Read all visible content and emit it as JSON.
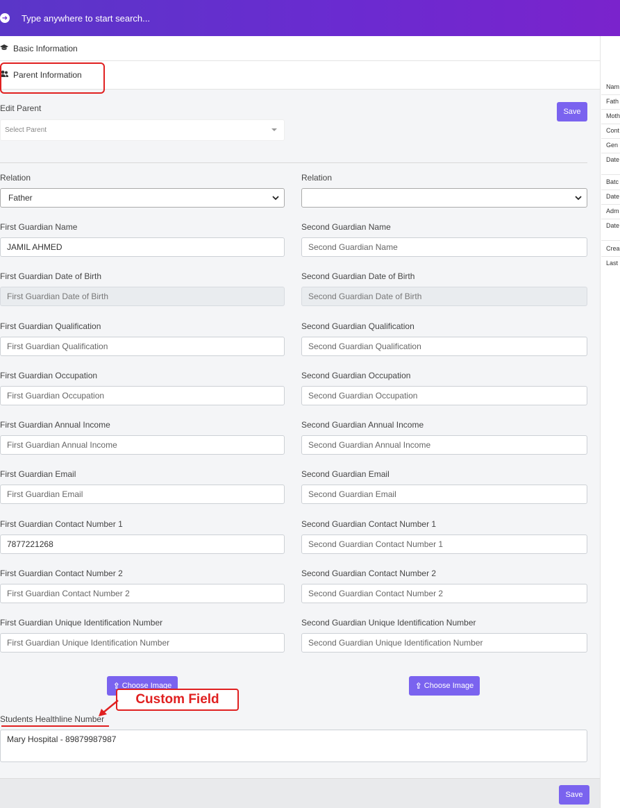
{
  "search": {
    "placeholder": "Type anywhere to start search...",
    "icon": "arrow-circle-right-icon"
  },
  "tabs": [
    {
      "label": "Basic Information",
      "icon": "graduation-cap-icon"
    },
    {
      "label": "Parent Information",
      "icon": "users-icon"
    }
  ],
  "edit_parent": {
    "label": "Edit Parent",
    "placeholder": "Select Parent"
  },
  "save_label": "Save",
  "first": {
    "relation_label": "Relation",
    "relation_value": "Father",
    "name_label": "First Guardian Name",
    "name_value": "JAMIL AHMED",
    "dob_label": "First Guardian Date of Birth",
    "dob_placeholder": "First Guardian Date of Birth",
    "qual_label": "First Guardian Qualification",
    "qual_placeholder": "First Guardian Qualification",
    "occ_label": "First Guardian Occupation",
    "occ_placeholder": "First Guardian Occupation",
    "income_label": "First Guardian Annual Income",
    "income_placeholder": "First Guardian Annual Income",
    "email_label": "First Guardian Email",
    "email_placeholder": "First Guardian Email",
    "contact1_label": "First Guardian Contact Number 1",
    "contact1_value": "7877221268",
    "contact2_label": "First Guardian Contact Number 2",
    "contact2_placeholder": "First Guardian Contact Number 2",
    "uid_label": "First Guardian Unique Identification Number",
    "uid_placeholder": "First Guardian Unique Identification Number"
  },
  "second": {
    "relation_label": "Relation",
    "relation_value": "",
    "name_label": "Second Guardian Name",
    "name_placeholder": "Second Guardian Name",
    "dob_label": "Second Guardian Date of Birth",
    "dob_placeholder": "Second Guardian Date of Birth",
    "qual_label": "Second Guardian Qualification",
    "qual_placeholder": "Second Guardian Qualification",
    "occ_label": "Second Guardian Occupation",
    "occ_placeholder": "Second Guardian Occupation",
    "income_label": "Second Guardian Annual Income",
    "income_placeholder": "Second Guardian Annual Income",
    "email_label": "Second Guardian Email",
    "email_placeholder": "Second Guardian Email",
    "contact1_label": "Second Guardian Contact Number 1",
    "contact1_placeholder": "Second Guardian Contact Number 1",
    "contact2_label": "Second Guardian Contact Number 2",
    "contact2_placeholder": "Second Guardian Contact Number 2",
    "uid_label": "Second Guardian Unique Identification Number",
    "uid_placeholder": "Second Guardian Unique Identification Number"
  },
  "choose_image_label": "Choose Image",
  "annotation": {
    "text": "Custom Field",
    "color": "#e02020"
  },
  "custom_field": {
    "label": "Students Healthline Number",
    "value": "Mary Hospital - 89879987987"
  },
  "right_panel": [
    "Nam",
    "Fath",
    "Moth",
    "Cont",
    "Gen",
    "Date",
    "Batc",
    "Date",
    "Adm",
    "Date",
    "Crea",
    "Last"
  ],
  "colors": {
    "accent": "#7a63ef",
    "header_start": "#5a36c8",
    "header_end": "#7a23cc",
    "highlight": "#e02020"
  }
}
